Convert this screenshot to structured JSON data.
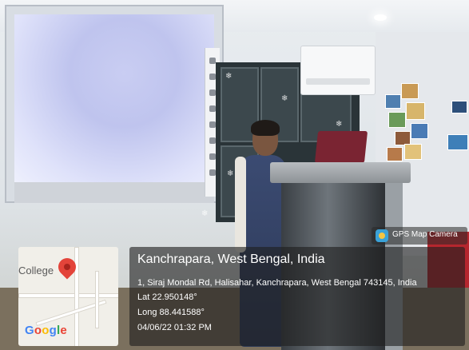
{
  "overlay": {
    "app_badge": "GPS Map Camera",
    "location_title": "Kanchrapara, West Bengal, India",
    "address": "1, Siraj Mondal Rd, Halisahar, Kanchrapara, West Bengal 743145, India",
    "latitude": "Lat 22.950148°",
    "longitude": "Long 88.441588°",
    "datetime": "04/06/22 01:32 PM"
  },
  "map": {
    "place_label": "College",
    "brand": "Google",
    "pin_color": "#e3443a"
  },
  "colors": {
    "overlay_bg": "#1e1e1e",
    "badge_icon": "#3aa2d8"
  }
}
